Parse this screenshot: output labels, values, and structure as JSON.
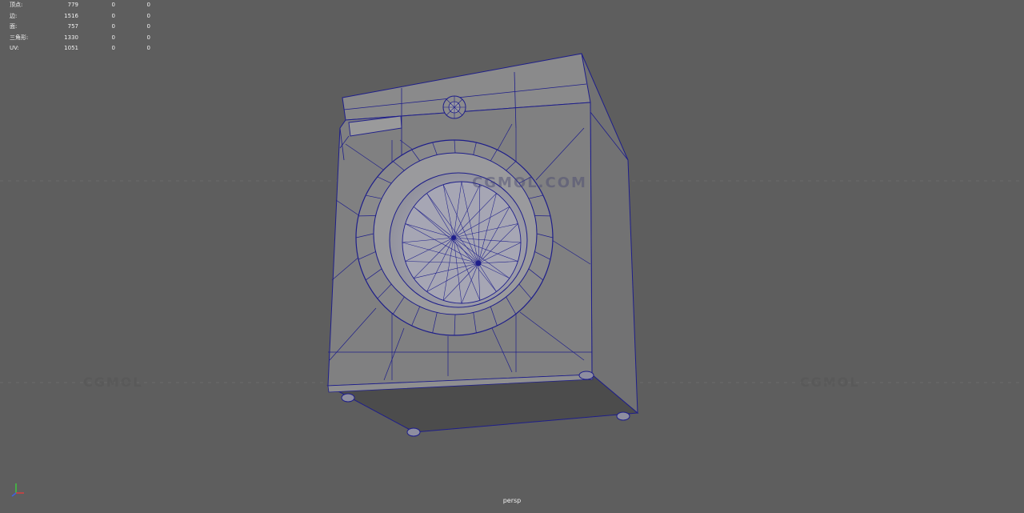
{
  "hud": {
    "rows": [
      {
        "label": "顶点:",
        "v1": "779",
        "v2": "0",
        "v3": "0"
      },
      {
        "label": "边:",
        "v1": "1516",
        "v2": "0",
        "v3": "0"
      },
      {
        "label": "面:",
        "v1": "757",
        "v2": "0",
        "v3": "0"
      },
      {
        "label": "三角形:",
        "v1": "1330",
        "v2": "0",
        "v3": "0"
      },
      {
        "label": "UV:",
        "v1": "1051",
        "v2": "0",
        "v3": "0"
      }
    ]
  },
  "viewport": {
    "camera": "persp",
    "background_color": "#5e5e5e",
    "wire_color": "#1e1e8a",
    "model_color": "#7f7f80"
  },
  "watermarks": {
    "text1": "CGMOL",
    "text2": "CGMOL.COM"
  },
  "icons": {
    "axis": "axis-gizmo-icon"
  }
}
